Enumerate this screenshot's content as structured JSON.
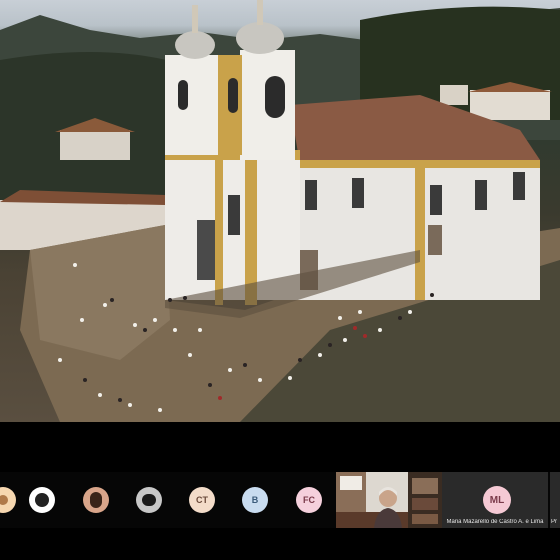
{
  "shared_screen": {
    "description_icon": "aerial-church-video-frame"
  },
  "participants": [
    {
      "initials": "",
      "bg": "#f6d7b0",
      "icon": "person-photo-avatar"
    },
    {
      "initials": "",
      "bg": "#ffffff",
      "icon": "person-photo-avatar"
    },
    {
      "initials": "",
      "bg": "#d9a58a",
      "icon": "person-photo-avatar"
    },
    {
      "initials": "",
      "bg": "#c7c7c7",
      "icon": "person-photo-avatar"
    },
    {
      "initials": "CT",
      "bg": "#f3dcc9"
    },
    {
      "initials": "B",
      "bg": "#c9dcf0"
    },
    {
      "initials": "FC",
      "bg": "#f5d0dc"
    }
  ],
  "video_tile": {
    "icon": "webcam-feed"
  },
  "named_tile": {
    "initials": "ML",
    "name": "Maria Mazarello de Castro A. e Lima"
  },
  "edge_tile": {
    "name": "Pr"
  }
}
